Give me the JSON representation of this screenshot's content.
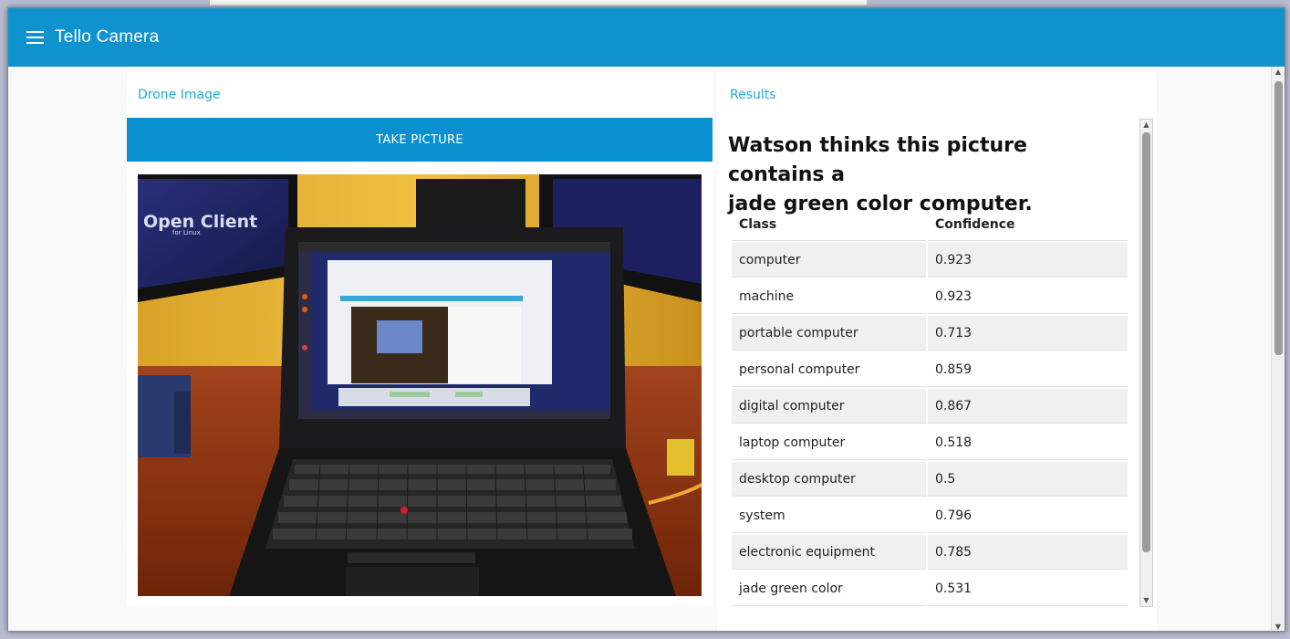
{
  "app": {
    "title": "Tello Camera"
  },
  "drone_panel": {
    "heading": "Drone Image",
    "button_label": "TAKE PICTURE",
    "image_alt": "Photo from drone of a laptop on a desk"
  },
  "results_panel": {
    "heading": "Results",
    "verdict_line1": "Watson thinks this picture contains a",
    "verdict_line2": "jade green color computer.",
    "columns": [
      "Class",
      "Confidence"
    ],
    "rows": [
      {
        "class": "computer",
        "confidence": "0.923"
      },
      {
        "class": "machine",
        "confidence": "0.923"
      },
      {
        "class": "portable computer",
        "confidence": "0.713"
      },
      {
        "class": "personal computer",
        "confidence": "0.859"
      },
      {
        "class": "digital computer",
        "confidence": "0.867"
      },
      {
        "class": "laptop computer",
        "confidence": "0.518"
      },
      {
        "class": "desktop computer",
        "confidence": "0.5"
      },
      {
        "class": "system",
        "confidence": "0.796"
      },
      {
        "class": "electronic equipment",
        "confidence": "0.785"
      },
      {
        "class": "jade green color",
        "confidence": "0.531"
      }
    ]
  },
  "photo": {
    "overlay_text": "Open Client",
    "overlay_sub": "for Linux"
  },
  "colors": {
    "appbar": "#0e93cf",
    "accent_text": "#24a8d8",
    "button": "#0a90ce"
  }
}
